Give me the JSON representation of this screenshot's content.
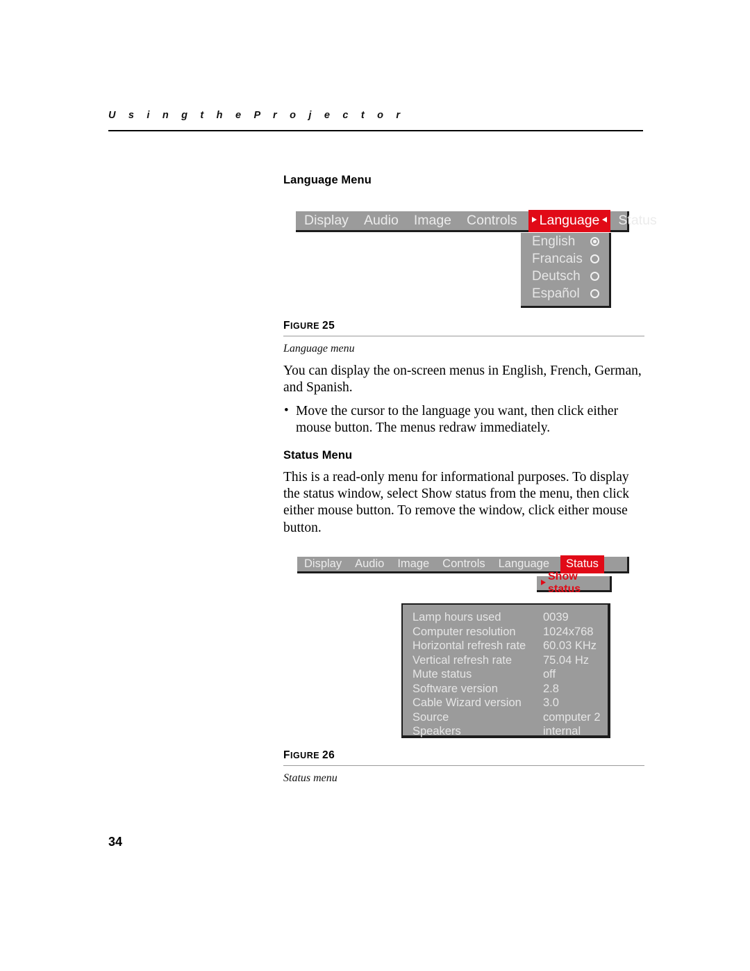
{
  "header": {
    "running_title": "U s i n g   t h e   P r o j e c t o r"
  },
  "page_number": "34",
  "sections": {
    "language": {
      "heading": "Language Menu",
      "paragraph": "You can display the on-screen menus in English, French, German, and Spanish.",
      "bullets": [
        "Move the cursor to the language you want, then click either mouse button. The menus redraw immediately."
      ]
    },
    "status": {
      "heading": "Status Menu",
      "paragraph": "This is a read-only menu for informational purposes. To display the status window, select Show status from the menu, then click either mouse button. To remove the window, click either mouse button."
    }
  },
  "figures": {
    "figure25": {
      "label_small": "IGURE",
      "label_first": "F",
      "label_number": "25",
      "caption": "Language menu"
    },
    "figure26": {
      "label_small": "IGURE",
      "label_first": "F",
      "label_number": "26",
      "caption": "Status menu"
    }
  },
  "osd_language_menu": {
    "menubar_items": [
      {
        "label": "Display",
        "active": false
      },
      {
        "label": "Audio",
        "active": false
      },
      {
        "label": "Image",
        "active": false
      },
      {
        "label": "Controls",
        "active": false
      },
      {
        "label": "Language",
        "active": true
      },
      {
        "label": "Status",
        "active": false
      }
    ],
    "dropdown_options": [
      {
        "label": "English",
        "selected": true
      },
      {
        "label": "Francais",
        "selected": false
      },
      {
        "label": "Deutsch",
        "selected": false
      },
      {
        "label": "Español",
        "selected": false
      }
    ]
  },
  "osd_status_menu": {
    "menubar_items": [
      {
        "label": "Display",
        "active": false
      },
      {
        "label": "Audio",
        "active": false
      },
      {
        "label": "Image",
        "active": false
      },
      {
        "label": "Controls",
        "active": false
      },
      {
        "label": "Language",
        "active": false
      },
      {
        "label": "Status",
        "active": true
      }
    ],
    "dropdown_item": "Show status",
    "status_rows": [
      {
        "key": "Lamp hours used",
        "value": "0039"
      },
      {
        "key": "Computer resolution",
        "value": "1024x768"
      },
      {
        "key": "Horizontal refresh rate",
        "value": "60.03 KHz"
      },
      {
        "key": "Vertical refresh rate",
        "value": "75.04 Hz"
      },
      {
        "key": "Mute status",
        "value": "off"
      },
      {
        "key": "Software version",
        "value": "2.8"
      },
      {
        "key": "Cable Wizard version",
        "value": "3.0"
      },
      {
        "key": "Source",
        "value": "computer 2"
      },
      {
        "key": "Speakers",
        "value": "internal"
      }
    ]
  },
  "colors": {
    "osd_gray": "#9b9b9b",
    "osd_highlight_red": "#e10a17",
    "osd_text": "#e6e6e6",
    "rule_gray": "#9a9a9a"
  }
}
